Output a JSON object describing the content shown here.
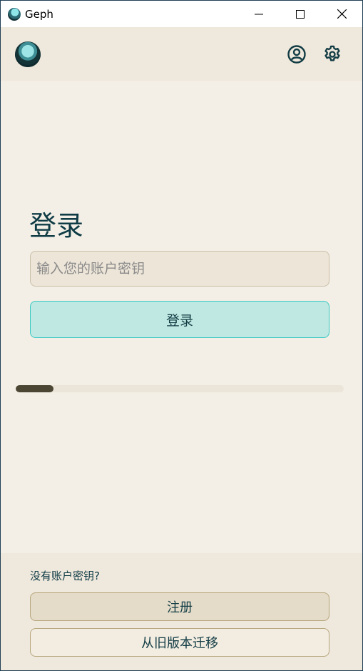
{
  "window": {
    "title": "Geph",
    "controls": [
      "minimize-icon",
      "maximize-icon",
      "close-icon"
    ]
  },
  "header": {
    "logo_icon": "geph-logo",
    "actions": [
      "account-icon",
      "settings-icon"
    ]
  },
  "login": {
    "title": "登录",
    "key_placeholder": "输入您的账户密钥",
    "key_value": "",
    "button_label": "登录",
    "progress": 0.115
  },
  "footer": {
    "no_key_text": "没有账户密钥?",
    "register_label": "注册",
    "migrate_label": "从旧版本迁移"
  },
  "colors": {
    "accent": "#38c9c4",
    "accent_fill": "#c0e8e2",
    "text_primary": "#0f3b45",
    "background": "#f3efe6",
    "progress_fill": "#4b4533"
  }
}
